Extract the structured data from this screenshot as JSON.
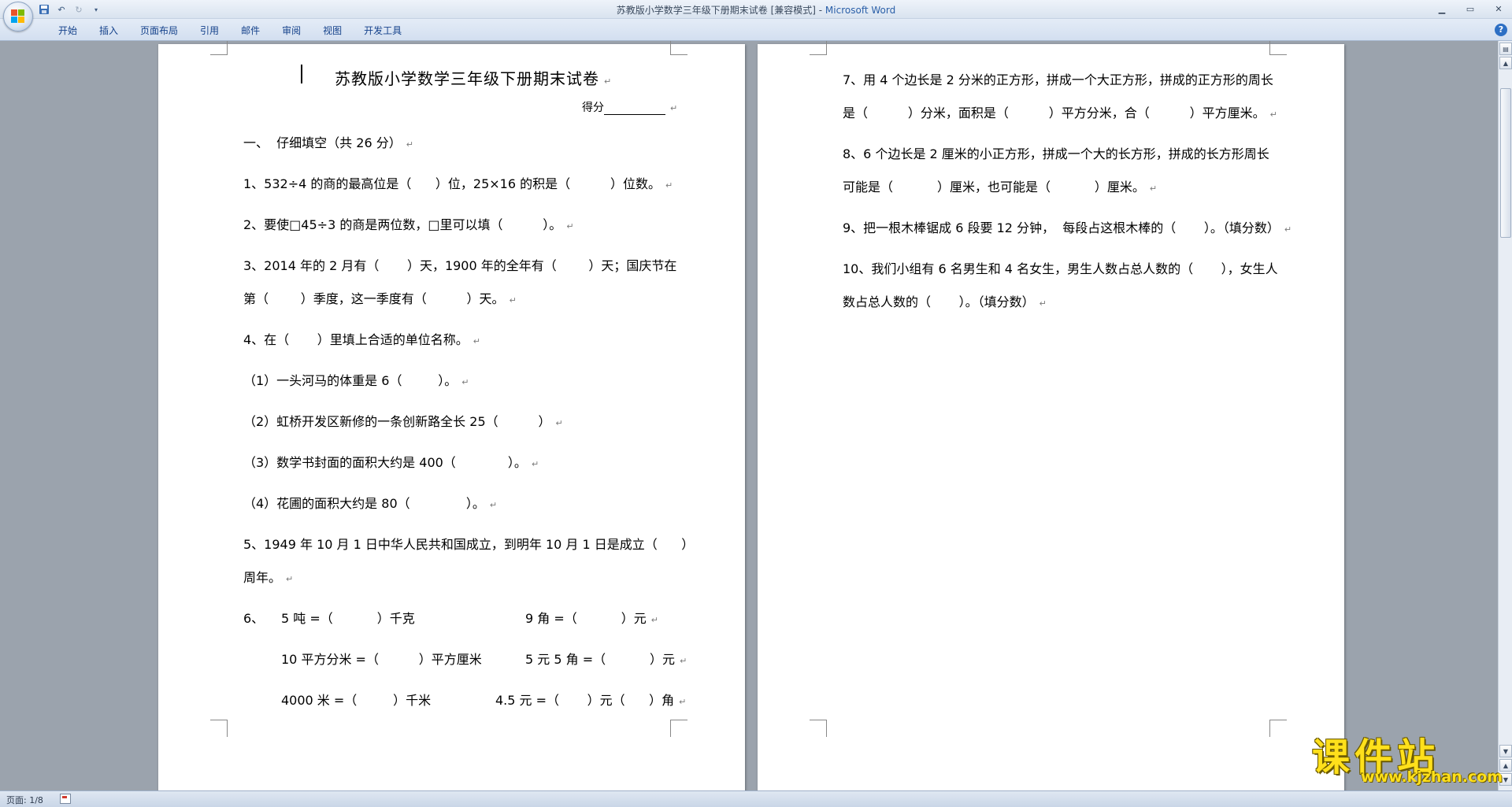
{
  "window": {
    "title_doc": "苏教版小学数学三年级下册期末试卷 [兼容模式] - ",
    "title_app": "Microsoft Word"
  },
  "ribbon": {
    "tabs": [
      "开始",
      "插入",
      "页面布局",
      "引用",
      "邮件",
      "审阅",
      "视图",
      "开发工具"
    ]
  },
  "status": {
    "page": "页面: 1/8"
  },
  "document": {
    "left": {
      "title": "苏教版小学数学三年级下册期末试卷",
      "score_label": "得分",
      "section1": "一、  仔细填空（共 26 分）",
      "q1": "1、532÷4 的商的最高位是（      ）位，25×16 的积是（          ）位数。",
      "q2": "2、要使□45÷3 的商是两位数，□里可以填（          ）。",
      "q3a": "3、2014 年的 2 月有（       ）天，1900 年的全年有（        ）天；国庆节在",
      "q3b": "第（        ）季度，这一季度有（          ）天。",
      "q4": "4、在（       ）里填上合适的单位名称。",
      "q4_1": "（1）一头河马的体重是 6（         ）。",
      "q4_2": "（2）虹桥开发区新修的一条创新路全长 25（          ）",
      "q4_3": "（3）数学书封面的面积大约是 400（             ）。",
      "q4_4": "（4）花圃的面积大约是 80（              ）。",
      "q5a": "5、1949 年 10 月 1 日中华人民共和国成立，到明年 10 月 1 日是成立（      ）",
      "q5b": "周年。",
      "q6_num": "6、",
      "q6_r1a": "5 吨 =（           ）千克",
      "q6_r1b": "9 角 =（           ）元",
      "q6_r2a": "10 平方分米 =（          ）平方厘米",
      "q6_r2b": "5 元 5 角 =（           ）元",
      "q6_r3a": "4000 米 =（         ）千米",
      "q6_r3b": "4.5 元 =（       ）元（      ）角"
    },
    "right": {
      "q7a": "7、用 4 个边长是 2 分米的正方形，拼成一个大正方形，拼成的正方形的周长",
      "q7b": "是（          ）分米，面积是（          ）平方分米，合（          ）平方厘米。",
      "q8a": "8、6 个边长是 2 厘米的小正方形，拼成一个大的长方形，拼成的长方形周长",
      "q8b": "可能是（           ）厘米，也可能是（           ）厘米。",
      "q9": "9、把一根木棒锯成 6 段要 12 分钟，  每段占这根木棒的（       ）。（填分数）",
      "q10a": "10、我们小组有 6 名男生和 4 名女生，男生人数占总人数的（       ），女生人",
      "q10b": "数占总人数的（       ）。（填分数）"
    }
  },
  "watermark": {
    "text": "课件站",
    "url": "www.kjzhan.com"
  }
}
